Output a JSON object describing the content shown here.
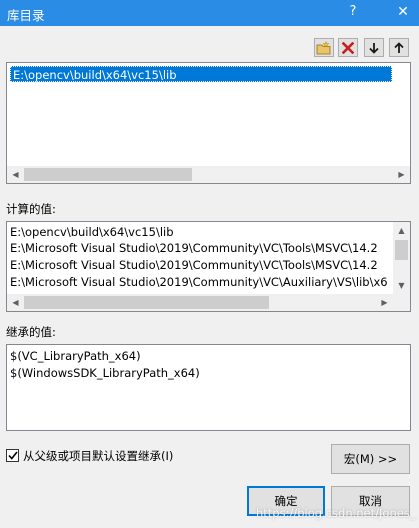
{
  "window": {
    "title": "库目录",
    "help_glyph": "?",
    "close_glyph": "✕"
  },
  "toolbar": {
    "buttons": [
      {
        "name": "new-line-button",
        "icon": "new-folder-icon"
      },
      {
        "name": "delete-button",
        "icon": "delete-x-icon"
      },
      {
        "name": "move-down-button",
        "icon": "arrow-down-icon"
      },
      {
        "name": "move-up-button",
        "icon": "arrow-up-icon"
      }
    ]
  },
  "editor": {
    "items": [
      "E:\\opencv\\build\\x64\\vc15\\lib"
    ]
  },
  "evaluated": {
    "label": "计算的值:",
    "items": [
      "E:\\opencv\\build\\x64\\vc15\\lib",
      "E:\\Microsoft Visual Studio\\2019\\Community\\VC\\Tools\\MSVC\\14.2",
      "E:\\Microsoft Visual Studio\\2019\\Community\\VC\\Tools\\MSVC\\14.2",
      "E:\\Microsoft Visual Studio\\2019\\Community\\VC\\Auxiliary\\VS\\lib\\x6"
    ]
  },
  "inherited": {
    "label": "继承的值:",
    "items": [
      "$(VC_LibraryPath_x64)",
      "$(WindowsSDK_LibraryPath_x64)"
    ]
  },
  "inherit_checkbox": {
    "label": "从父级或项目默认设置继承(I)",
    "checked": true
  },
  "buttons": {
    "macros": "宏(M) >>",
    "ok": "确定",
    "cancel": "取消"
  },
  "watermark": "https://blog.csdn.net/Jones_"
}
